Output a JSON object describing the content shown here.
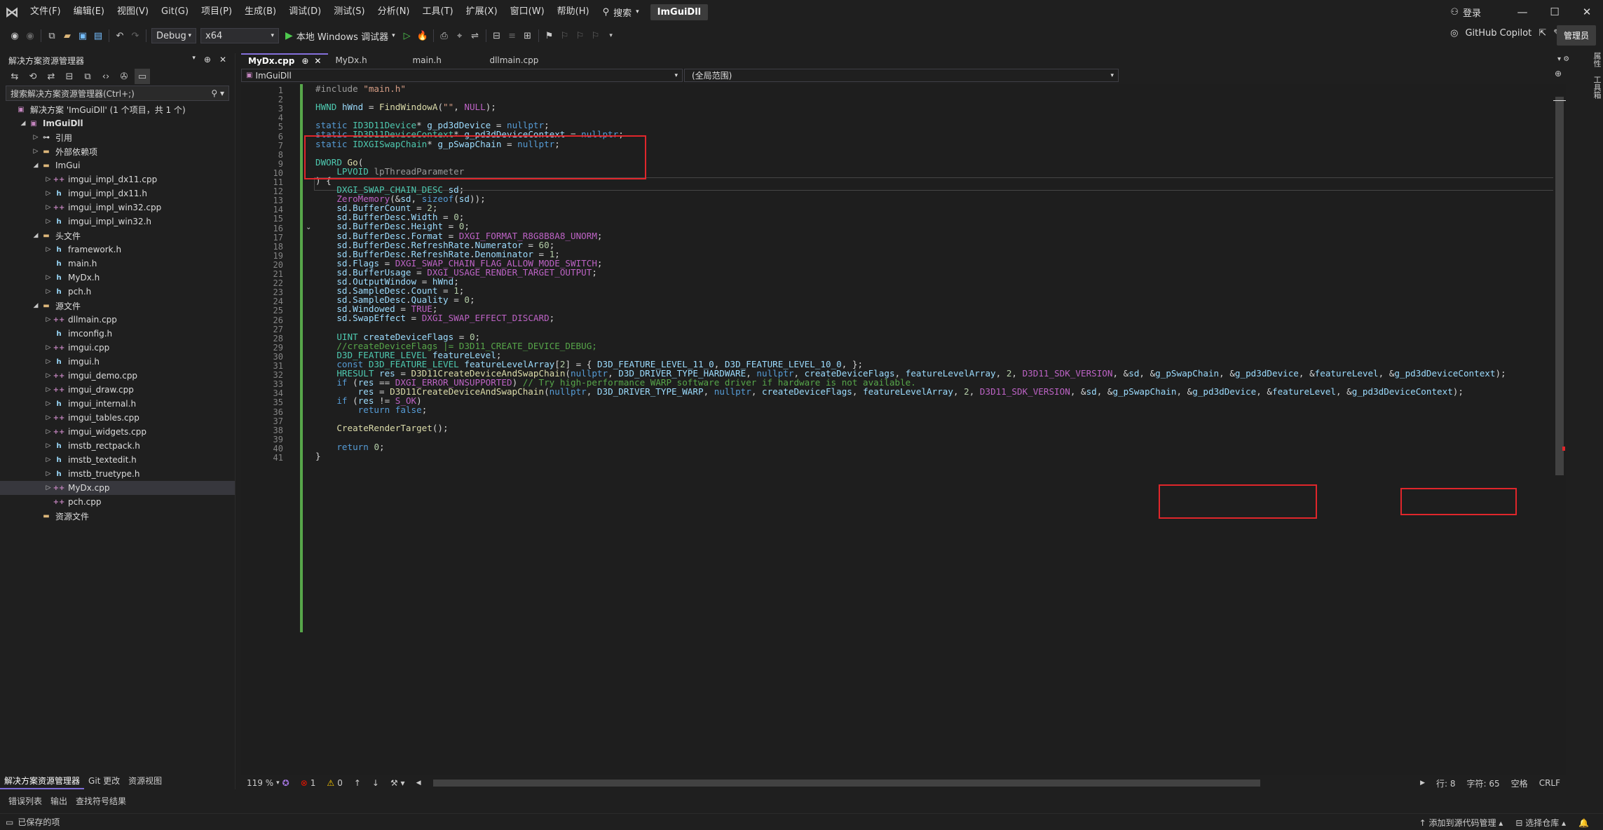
{
  "menu": {
    "items": [
      "文件(F)",
      "编辑(E)",
      "视图(V)",
      "Git(G)",
      "项目(P)",
      "生成(B)",
      "调试(D)",
      "测试(S)",
      "分析(N)",
      "工具(T)",
      "扩展(X)",
      "窗口(W)",
      "帮助(H)"
    ],
    "search_label": "搜索",
    "solution_name": "ImGuiDll",
    "login_label": "登录"
  },
  "toolbar": {
    "config": "Debug",
    "platform": "x64",
    "run_label": "本地 Windows 调试器",
    "copilot_label": "GitHub Copilot",
    "admin_label": "管理员"
  },
  "right_strip": {
    "label1": "属性",
    "label2": "工具箱"
  },
  "solution_explorer": {
    "title": "解决方案资源管理器",
    "search_placeholder": "搜索解决方案资源管理器(Ctrl+;)",
    "tree": [
      {
        "label": "解决方案 'ImGuiDll' (1 个项目，共 1 个)",
        "depth": 0,
        "arrow": "",
        "icon": "sol",
        "glyph": "▣"
      },
      {
        "label": "ImGuiDll",
        "depth": 1,
        "arrow": "◢",
        "icon": "proj",
        "glyph": "▣",
        "bold": true
      },
      {
        "label": "引用",
        "depth": 2,
        "arrow": "▷",
        "icon": "ref",
        "glyph": "⊶"
      },
      {
        "label": "外部依赖项",
        "depth": 2,
        "arrow": "▷",
        "icon": "folder",
        "glyph": "▬"
      },
      {
        "label": "ImGui",
        "depth": 2,
        "arrow": "◢",
        "icon": "folder",
        "glyph": "▬"
      },
      {
        "label": "imgui_impl_dx11.cpp",
        "depth": 3,
        "arrow": "▷",
        "icon": "cpp",
        "glyph": "++"
      },
      {
        "label": "imgui_impl_dx11.h",
        "depth": 3,
        "arrow": "▷",
        "icon": "h",
        "glyph": "h"
      },
      {
        "label": "imgui_impl_win32.cpp",
        "depth": 3,
        "arrow": "▷",
        "icon": "cpp",
        "glyph": "++"
      },
      {
        "label": "imgui_impl_win32.h",
        "depth": 3,
        "arrow": "▷",
        "icon": "h",
        "glyph": "h"
      },
      {
        "label": "头文件",
        "depth": 2,
        "arrow": "◢",
        "icon": "folder",
        "glyph": "▬"
      },
      {
        "label": "framework.h",
        "depth": 3,
        "arrow": "▷",
        "icon": "h",
        "glyph": "h"
      },
      {
        "label": "main.h",
        "depth": 3,
        "arrow": "",
        "icon": "h",
        "glyph": "h"
      },
      {
        "label": "MyDx.h",
        "depth": 3,
        "arrow": "▷",
        "icon": "h",
        "glyph": "h"
      },
      {
        "label": "pch.h",
        "depth": 3,
        "arrow": "▷",
        "icon": "h",
        "glyph": "h"
      },
      {
        "label": "源文件",
        "depth": 2,
        "arrow": "◢",
        "icon": "folder",
        "glyph": "▬"
      },
      {
        "label": "dllmain.cpp",
        "depth": 3,
        "arrow": "▷",
        "icon": "cpp",
        "glyph": "++"
      },
      {
        "label": "imconfig.h",
        "depth": 3,
        "arrow": "",
        "icon": "h",
        "glyph": "h"
      },
      {
        "label": "imgui.cpp",
        "depth": 3,
        "arrow": "▷",
        "icon": "cpp",
        "glyph": "++"
      },
      {
        "label": "imgui.h",
        "depth": 3,
        "arrow": "▷",
        "icon": "h",
        "glyph": "h"
      },
      {
        "label": "imgui_demo.cpp",
        "depth": 3,
        "arrow": "▷",
        "icon": "cpp",
        "glyph": "++"
      },
      {
        "label": "imgui_draw.cpp",
        "depth": 3,
        "arrow": "▷",
        "icon": "cpp",
        "glyph": "++"
      },
      {
        "label": "imgui_internal.h",
        "depth": 3,
        "arrow": "▷",
        "icon": "h",
        "glyph": "h"
      },
      {
        "label": "imgui_tables.cpp",
        "depth": 3,
        "arrow": "▷",
        "icon": "cpp",
        "glyph": "++"
      },
      {
        "label": "imgui_widgets.cpp",
        "depth": 3,
        "arrow": "▷",
        "icon": "cpp",
        "glyph": "++"
      },
      {
        "label": "imstb_rectpack.h",
        "depth": 3,
        "arrow": "▷",
        "icon": "h",
        "glyph": "h"
      },
      {
        "label": "imstb_textedit.h",
        "depth": 3,
        "arrow": "▷",
        "icon": "h",
        "glyph": "h"
      },
      {
        "label": "imstb_truetype.h",
        "depth": 3,
        "arrow": "▷",
        "icon": "h",
        "glyph": "h"
      },
      {
        "label": "MyDx.cpp",
        "depth": 3,
        "arrow": "▷",
        "icon": "cpp",
        "glyph": "++",
        "selected": true
      },
      {
        "label": "pch.cpp",
        "depth": 3,
        "arrow": "",
        "icon": "cpp",
        "glyph": "++"
      },
      {
        "label": "资源文件",
        "depth": 2,
        "arrow": "",
        "icon": "folder",
        "glyph": "▬"
      }
    ],
    "bottom_tabs": [
      "解决方案资源管理器",
      "Git 更改",
      "资源视图"
    ]
  },
  "doc_tabs": [
    {
      "label": "MyDx.cpp",
      "active": true,
      "pin": "⊕",
      "close": "✕"
    },
    {
      "label": "MyDx.h"
    },
    {
      "label": "main.h"
    },
    {
      "label": "dllmain.cpp"
    }
  ],
  "nav": {
    "project": "ImGuiDll",
    "scope": "(全局范围)"
  },
  "code_lines": [
    "<span class=\"pp\">#include</span> <span class=\"st\">\"main.h\"</span>",
    "",
    "<span class=\"ty\">HWND</span> <span class=\"vr\">hWnd</span> = <span class=\"fn\">FindWindowA</span>(<span class=\"st\">\"\"</span>, <span class=\"mc\">NULL</span>);",
    "",
    "<span class=\"kw\">static</span> <span class=\"ty\">ID3D11Device</span>* <span class=\"vr\">g_pd3dDevice</span> = <span class=\"kw\">nullptr</span>;",
    "<span class=\"kw\">static</span> <span class=\"ty\">ID3D11DeviceContext</span>* <span class=\"vr\">g_pd3dDeviceContext</span> = <span class=\"kw\">nullptr</span>;",
    "<span class=\"kw\">static</span> <span class=\"ty\">IDXGISwapChain</span>* <span class=\"vr\">g_pSwapChain</span> = <span class=\"kw\">nullptr</span>;",
    "",
    "<span class=\"ty\">DWORD</span> <span class=\"fn\">Go</span>(",
    "    <span class=\"ty\">LPVOID</span> <span class=\"pa\">lpThreadParameter</span>",
    ") {",
    "    <span class=\"ty\">DXGI_SWAP_CHAIN_DESC</span> <span class=\"vr\">sd</span>;",
    "    <span class=\"mc\">ZeroMemory</span>(&amp;<span class=\"vr\">sd</span>, <span class=\"kw\">sizeof</span>(<span class=\"vr\">sd</span>));",
    "    <span class=\"vr\">sd</span>.<span class=\"vr\">BufferCount</span> = <span class=\"nm\">2</span>;",
    "    <span class=\"vr\">sd</span>.<span class=\"vr\">BufferDesc</span>.<span class=\"vr\">Width</span> = <span class=\"nm\">0</span>;",
    "    <span class=\"vr\">sd</span>.<span class=\"vr\">BufferDesc</span>.<span class=\"vr\">Height</span> = <span class=\"nm\">0</span>;",
    "    <span class=\"vr\">sd</span>.<span class=\"vr\">BufferDesc</span>.<span class=\"vr\">Format</span> = <span class=\"mc\">DXGI_FORMAT_R8G8B8A8_UNORM</span>;",
    "    <span class=\"vr\">sd</span>.<span class=\"vr\">BufferDesc</span>.<span class=\"vr\">RefreshRate</span>.<span class=\"vr\">Numerator</span> = <span class=\"nm\">60</span>;",
    "    <span class=\"vr\">sd</span>.<span class=\"vr\">BufferDesc</span>.<span class=\"vr\">RefreshRate</span>.<span class=\"vr\">Denominator</span> = <span class=\"nm\">1</span>;",
    "    <span class=\"vr\">sd</span>.<span class=\"vr\">Flags</span> = <span class=\"mc\">DXGI_SWAP_CHAIN_FLAG_ALLOW_MODE_SWITCH</span>;",
    "    <span class=\"vr\">sd</span>.<span class=\"vr\">BufferUsage</span> = <span class=\"mc\">DXGI_USAGE_RENDER_TARGET_OUTPUT</span>;",
    "    <span class=\"vr\">sd</span>.<span class=\"vr\">OutputWindow</span> = <span class=\"vr\">hWnd</span>;",
    "    <span class=\"vr\">sd</span>.<span class=\"vr\">SampleDesc</span>.<span class=\"vr\">Count</span> = <span class=\"nm\">1</span>;",
    "    <span class=\"vr\">sd</span>.<span class=\"vr\">SampleDesc</span>.<span class=\"vr\">Quality</span> = <span class=\"nm\">0</span>;",
    "    <span class=\"vr\">sd</span>.<span class=\"vr\">Windowed</span> = <span class=\"mc\">TRUE</span>;",
    "    <span class=\"vr\">sd</span>.<span class=\"vr\">SwapEffect</span> = <span class=\"mc\">DXGI_SWAP_EFFECT_DISCARD</span>;",
    "",
    "    <span class=\"ty\">UINT</span> <span class=\"vr\">createDeviceFlags</span> = <span class=\"nm\">0</span>;",
    "    <span class=\"cm\">//createDeviceFlags |= D3D11_CREATE_DEVICE_DEBUG;</span>",
    "    <span class=\"ty\">D3D_FEATURE_LEVEL</span> <span class=\"vr\">featureLevel</span>;",
    "    <span class=\"kw\">const</span> <span class=\"ty\">D3D_FEATURE_LEVEL</span> <span class=\"vr\">featureLevelArray</span>[<span class=\"nm\">2</span>] = { <span class=\"vr\">D3D_FEATURE_LEVEL_11_0</span>, <span class=\"vr\">D3D_FEATURE_LEVEL_10_0</span>, };",
    "    <span class=\"ty\">HRESULT</span> <span class=\"vr\">res</span> = <span class=\"fn\">D3D11CreateDeviceAndSwapChain</span>(<span class=\"kw\">nullptr</span>, <span class=\"vr\">D3D_DRIVER_TYPE_HARDWARE</span>, <span class=\"kw\">nullptr</span>, <span class=\"vr\">createDeviceFlags</span>, <span class=\"vr\">featureLevelArray</span>, <span class=\"nm\">2</span>, <span class=\"mc\">D3D11_SDK_VERSION</span>, &amp;<span class=\"vr\">sd</span>, &amp;<span class=\"vr\">g_pSwapChain</span>, &amp;<span class=\"vr\">g_pd3dDevice</span>, &amp;<span class=\"vr\">featureLevel</span>, &amp;<span class=\"vr\">g_pd3dDeviceContext</span>);",
    "    <span class=\"kw\">if</span> (<span class=\"vr\">res</span> == <span class=\"mc\">DXGI_ERROR_UNSUPPORTED</span>) <span class=\"cm\">// Try high-performance WARP software driver if hardware is not available.</span>",
    "        <span class=\"vr\">res</span> = <span class=\"fn\">D3D11CreateDeviceAndSwapChain</span>(<span class=\"kw\">nullptr</span>, <span class=\"vr\">D3D_DRIVER_TYPE_WARP</span>, <span class=\"kw\">nullptr</span>, <span class=\"vr\">createDeviceFlags</span>, <span class=\"vr\">featureLevelArray</span>, <span class=\"nm\">2</span>, <span class=\"mc\">D3D11_SDK_VERSION</span>, &amp;<span class=\"vr\">sd</span>, &amp;<span class=\"vr\">g_pSwapChain</span>, &amp;<span class=\"vr\">g_pd3dDevice</span>, &amp;<span class=\"vr\">featureLevel</span>, &amp;<span class=\"vr\">g_pd3dDeviceContext</span>);",
    "    <span class=\"kw\">if</span> (<span class=\"vr\">res</span> != <span class=\"mc\">S_OK</span>)",
    "        <span class=\"kw\">return</span> <span class=\"kw\">false</span>;",
    "",
    "    <span class=\"fn\">CreateRenderTarget</span>();",
    "",
    "    <span class=\"kw\">return</span> <span class=\"nm\">0</span>;",
    "}"
  ],
  "editor_status": {
    "zoom": "119 %",
    "errors": "1",
    "warnings": "0",
    "line": "行: 8",
    "col": "字符: 65",
    "spaces": "空格",
    "eol": "CRLF"
  },
  "bottom_tabs": [
    "错误列表",
    "输出",
    "查找符号结果"
  ],
  "status_bar": {
    "saved": "已保存的项",
    "source_control": "添加到源代码管理",
    "repo": "选择仓库"
  }
}
